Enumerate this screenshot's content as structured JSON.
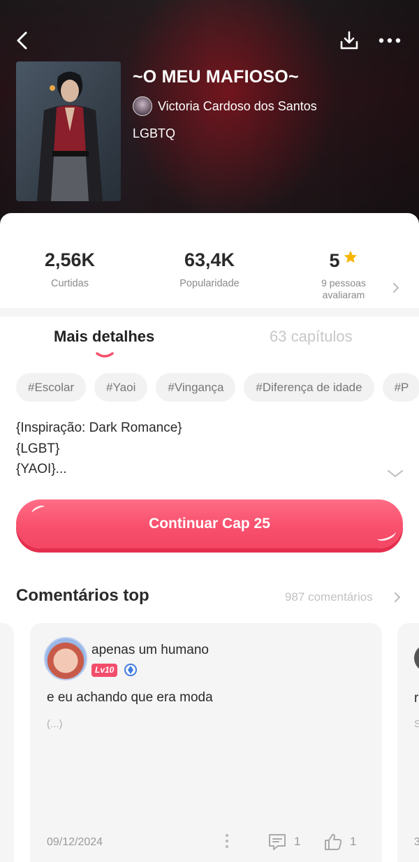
{
  "header": {
    "book_title": "~O MEU MAFIOSO~",
    "author": "Victoria Cardoso dos Santos",
    "genre": "LGBTQ"
  },
  "stats": {
    "likes_value": "2,56K",
    "likes_label": "Curtidas",
    "popularity_value": "63,4K",
    "popularity_label": "Popularidade",
    "rating_value": "5",
    "rating_line1": "9 pessoas",
    "rating_line2": "avaliaram"
  },
  "tabs": {
    "details": "Mais detalhes",
    "chapters": "63 capítulos"
  },
  "tags": [
    "#Escolar",
    "#Yaoi",
    "#Vingança",
    "#Diferença de idade",
    "#P"
  ],
  "description": {
    "line1": "{Inspiração: Dark Romance}",
    "line2": "{LGBT}",
    "line3": "{YAOI}..."
  },
  "continue_button": "Continuar Cap 25",
  "comments": {
    "title": "Comentários top",
    "count": "987 comentários",
    "main": {
      "user": "apenas um humano",
      "level": "Lv10",
      "text": "e eu achando que era moda",
      "ellipsis": "(...)",
      "date": "09/12/2024",
      "replies": "1",
      "likes": "1"
    },
    "peek_right": {
      "text": "r",
      "sub": "S",
      "num": "3"
    }
  },
  "colors": {
    "accent": "#f8506d",
    "star": "#f7b500",
    "muted": "#8a8a8a"
  }
}
